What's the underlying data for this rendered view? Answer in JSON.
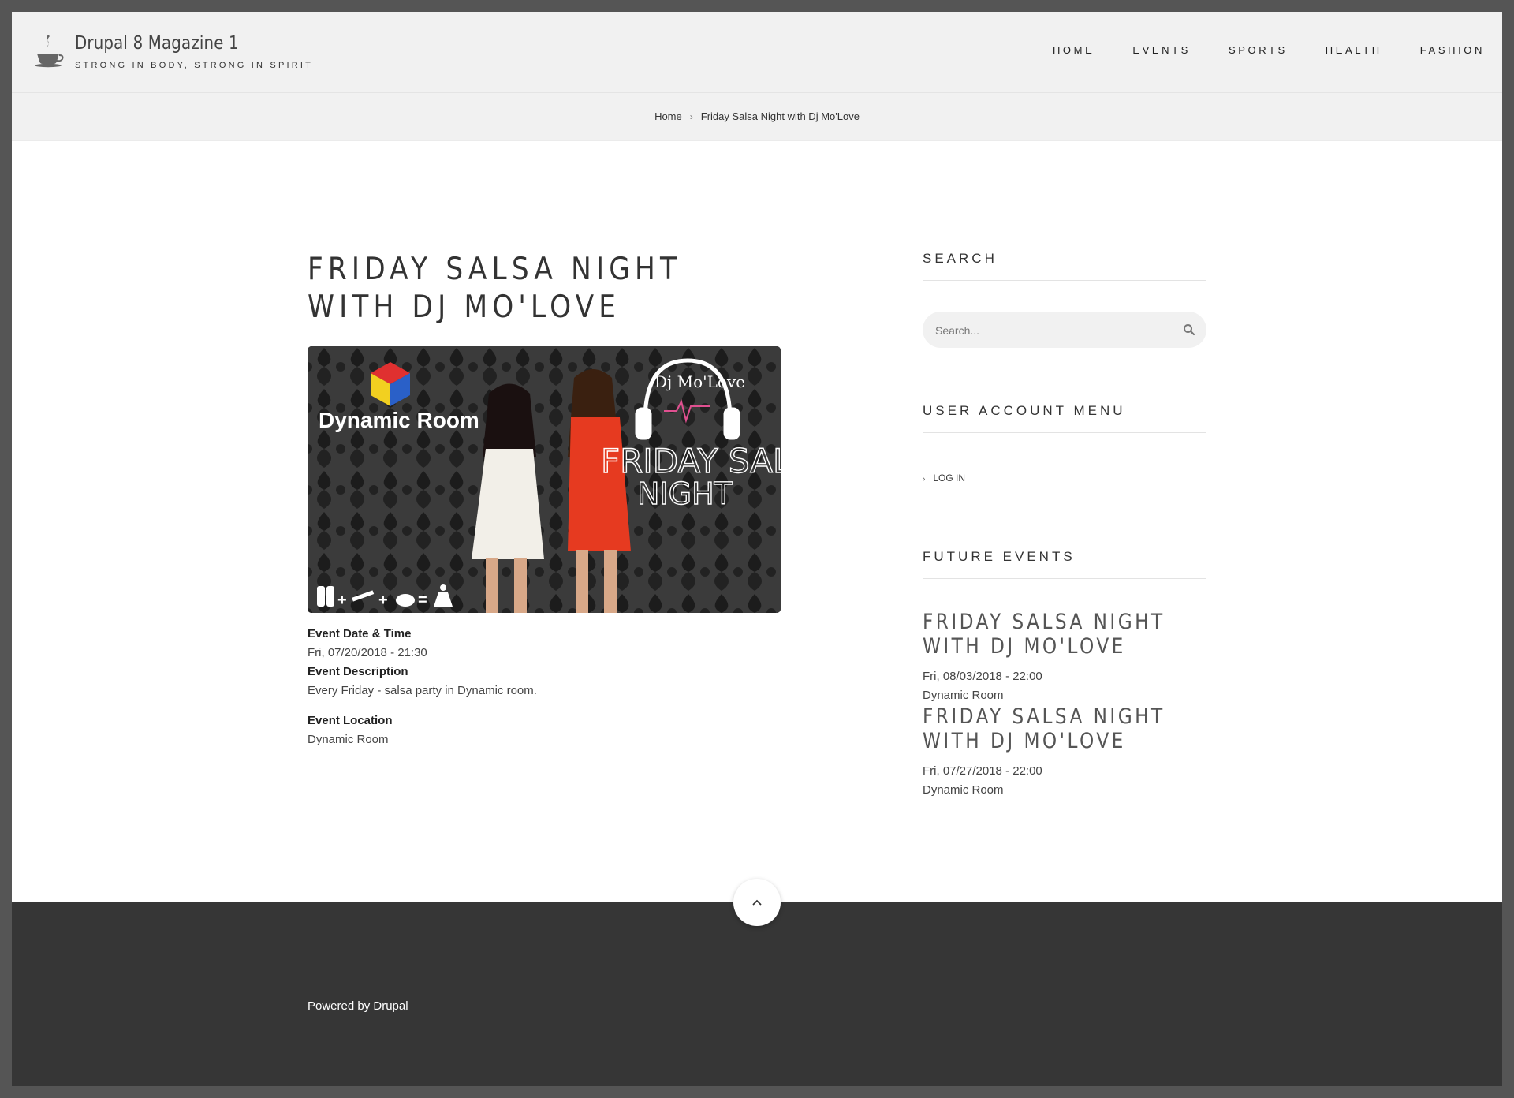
{
  "site": {
    "name": "Drupal 8 Magazine 1",
    "slogan": "STRONG IN BODY, STRONG IN SPIRIT"
  },
  "nav": {
    "items": [
      {
        "label": "HOME"
      },
      {
        "label": "EVENTS"
      },
      {
        "label": "SPORTS"
      },
      {
        "label": "HEALTH"
      },
      {
        "label": "FASHION"
      }
    ]
  },
  "breadcrumb": {
    "home": "Home",
    "separator": "›",
    "current": "Friday Salsa Night with Dj Mo'Love"
  },
  "event": {
    "title": "FRIDAY SALSA NIGHT WITH DJ MO'LOVE",
    "poster": {
      "venue_text": "Dynamic Room",
      "dj_text": "Dj Mo'Love",
      "headline_line1": "FRIDAY SALSA",
      "headline_line2": "NIGHT"
    },
    "date_label": "Event Date & Time",
    "date_value": "Fri, 07/20/2018 - 21:30",
    "description_label": "Event Description",
    "description_value": "Every Friday - salsa party in Dynamic room.",
    "location_label": "Event Location",
    "location_value": "Dynamic Room"
  },
  "sidebar": {
    "search_title": "SEARCH",
    "search_placeholder": "Search...",
    "account_title": "USER ACCOUNT MENU",
    "login_label": "LOG IN",
    "future_title": "FUTURE EVENTS",
    "future_events": [
      {
        "title_line1": "FRIDAY SALSA NIGHT",
        "title_line2": "WITH DJ MO'LOVE",
        "date": "Fri, 08/03/2018 - 22:00",
        "location": "Dynamic Room"
      },
      {
        "title_line1": "FRIDAY SALSA NIGHT",
        "title_line2": "WITH DJ MO'LOVE",
        "date": "Fri, 07/27/2018 - 22:00",
        "location": "Dynamic Room"
      }
    ]
  },
  "footer": {
    "powered_prefix": "Powered by",
    "powered_link": "Drupal"
  },
  "colors": {
    "page_frame": "#555555",
    "header_bg": "#f1f1f1",
    "footer_bg": "#363636",
    "text": "#333333"
  }
}
